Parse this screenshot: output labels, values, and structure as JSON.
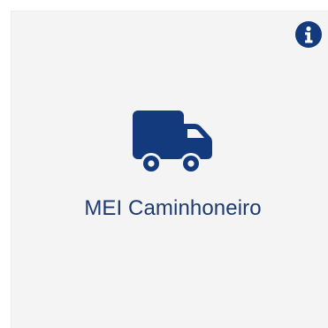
{
  "card": {
    "label": "MEI Caminhoneiro",
    "icon": "truck-icon",
    "info_icon": "info-icon"
  },
  "colors": {
    "brand": "#133a7c",
    "text": "#1c3b73",
    "card_background": "#f4f4f4"
  }
}
